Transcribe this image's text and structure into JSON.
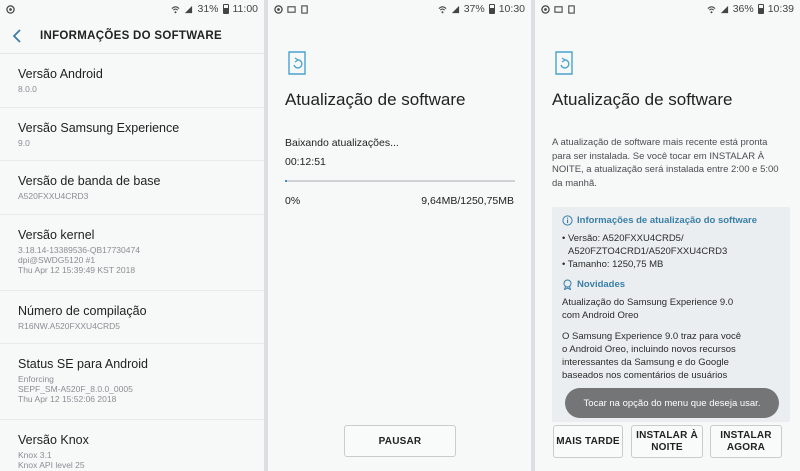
{
  "panel1": {
    "status": {
      "battery": "31%",
      "time": "11:00"
    },
    "header_title": "INFORMAÇÕES DO SOFTWARE",
    "items": [
      {
        "title": "Versão Android",
        "lines": [
          "8.0.0"
        ]
      },
      {
        "title": "Versão Samsung Experience",
        "lines": [
          "9.0"
        ]
      },
      {
        "title": "Versão de banda de base",
        "lines": [
          "A520FXXU4CRD3"
        ]
      },
      {
        "title": "Versão kernel",
        "lines": [
          "3.18.14-13389536-QB17730474",
          "dpi@SWDG5120 #1",
          "Thu Apr 12 15:39:49 KST 2018"
        ]
      },
      {
        "title": "Número de compilação",
        "lines": [
          "R16NW.A520FXXU4CRD5"
        ]
      },
      {
        "title": "Status SE para Android",
        "lines": [
          "Enforcing",
          "SEPF_SM-A520F_8.0.0_0005",
          "Thu Apr 12 15:52:06 2018"
        ]
      },
      {
        "title": "Versão Knox",
        "lines": [
          "Knox 3.1",
          "Knox API level 25"
        ]
      }
    ]
  },
  "panel2": {
    "status": {
      "battery": "37%",
      "time": "10:30"
    },
    "title": "Atualização de software",
    "downloading": "Baixando atualizações...",
    "elapsed": "00:12:51",
    "percent": "0%",
    "progress_fraction": 0.01,
    "size": "9,64MB/1250,75MB",
    "pause_button": "PAUSAR"
  },
  "panel3": {
    "status": {
      "battery": "36%",
      "time": "10:39"
    },
    "title": "Atualização de software",
    "intro": "A atualização de software mais recente está pronta para ser instalada. Se você tocar em INSTALAR À NOITE, a atualização será instalada entre 2:00 e 5:00 da manhã.",
    "info_heading": "Informações de atualização do software",
    "version_line1": "• Versão: A520FXXU4CRD5/",
    "version_line2": "A520FZTO4CRD1/A520FXXU4CRD3",
    "size_line": "• Tamanho: 1250,75 MB",
    "news_heading": "Novidades",
    "news_line1": "Atualização do Samsung Experience 9.0",
    "news_line2": "com Android Oreo",
    "desc_line1": "O Samsung Experience 9.0 traz para você",
    "desc_line2": "o Android Oreo, incluindo novos recursos",
    "desc_line3": "interessantes da Samsung e do Google",
    "desc_line4": "baseados nos comentários de usuários",
    "toast": "Tocar na opção do menu que deseja usar.",
    "btn_later": "MAIS TARDE",
    "btn_night_1": "INSTALAR À",
    "btn_night_2": "NOITE",
    "btn_now_1": "INSTALAR",
    "btn_now_2": "AGORA"
  },
  "colors": {
    "accent": "#3b8fd0",
    "info_heading": "#3a7fa8"
  }
}
